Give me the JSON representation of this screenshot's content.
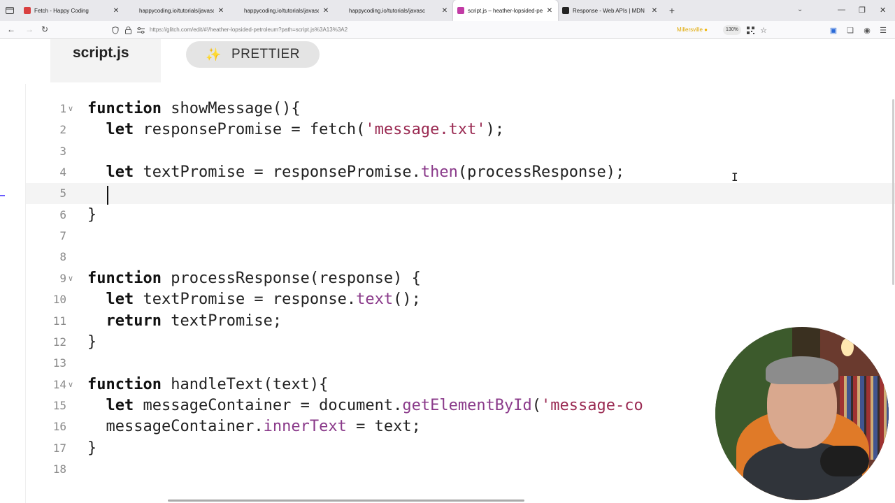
{
  "browser": {
    "tabs": [
      {
        "title": "Fetch - Happy Coding",
        "icon_color": "#d94040",
        "active": false
      },
      {
        "title": "happycoding.io/tutorials/javascript",
        "icon_color": "#e8e8ec",
        "active": false
      },
      {
        "title": "happycoding.io/tutorials/javascript",
        "icon_color": "#e8e8ec",
        "active": false
      },
      {
        "title": "happycoding.io/tutorials/javasc",
        "icon_color": "#e8e8ec",
        "active": false
      },
      {
        "title": "script.js – heather-lopsided-pe",
        "icon_color": "#c23ba5",
        "active": true
      },
      {
        "title": "Response - Web APIs | MDN",
        "icon_color": "#222222",
        "active": false
      }
    ],
    "close_glyph": "✕",
    "new_tab_glyph": "+",
    "url": "https://glitch.com/edit/#!/heather-lopsided-petroleum?path=script.js%3A13%3A2",
    "location_badge": "Millersville",
    "zoom": "130%"
  },
  "editor": {
    "filename": "script.js",
    "prettier_label": "PRETTIER",
    "prettier_icon": "✨",
    "current_line": 5,
    "lines": [
      {
        "n": "1",
        "fold": true,
        "html": "function showMessage(){"
      },
      {
        "n": "2",
        "fold": false,
        "html": "  let responsePromise = fetch('message.txt');"
      },
      {
        "n": "3",
        "fold": false,
        "html": ""
      },
      {
        "n": "4",
        "fold": false,
        "html": "  let textPromise = responsePromise.then(processResponse);"
      },
      {
        "n": "5",
        "fold": false,
        "html": ""
      },
      {
        "n": "6",
        "fold": false,
        "html": "}"
      },
      {
        "n": "7",
        "fold": false,
        "html": ""
      },
      {
        "n": "8",
        "fold": false,
        "html": ""
      },
      {
        "n": "9",
        "fold": true,
        "html": "function processResponse(response) {"
      },
      {
        "n": "10",
        "fold": false,
        "html": "  let textPromise = response.text();"
      },
      {
        "n": "11",
        "fold": false,
        "html": "  return textPromise;"
      },
      {
        "n": "12",
        "fold": false,
        "html": "}"
      },
      {
        "n": "13",
        "fold": false,
        "html": ""
      },
      {
        "n": "14",
        "fold": true,
        "html": "function handleText(text){"
      },
      {
        "n": "15",
        "fold": false,
        "html": "  let messageContainer = document.getElementById('message-co"
      },
      {
        "n": "16",
        "fold": false,
        "html": "  messageContainer.innerText = text;"
      },
      {
        "n": "17",
        "fold": false,
        "html": "}"
      },
      {
        "n": "18",
        "fold": false,
        "html": ""
      }
    ]
  },
  "colors": {
    "keyword": "#111111",
    "string": "#9a2a52",
    "method": "#8a3a8a",
    "line_number": "#8a8a8a"
  }
}
